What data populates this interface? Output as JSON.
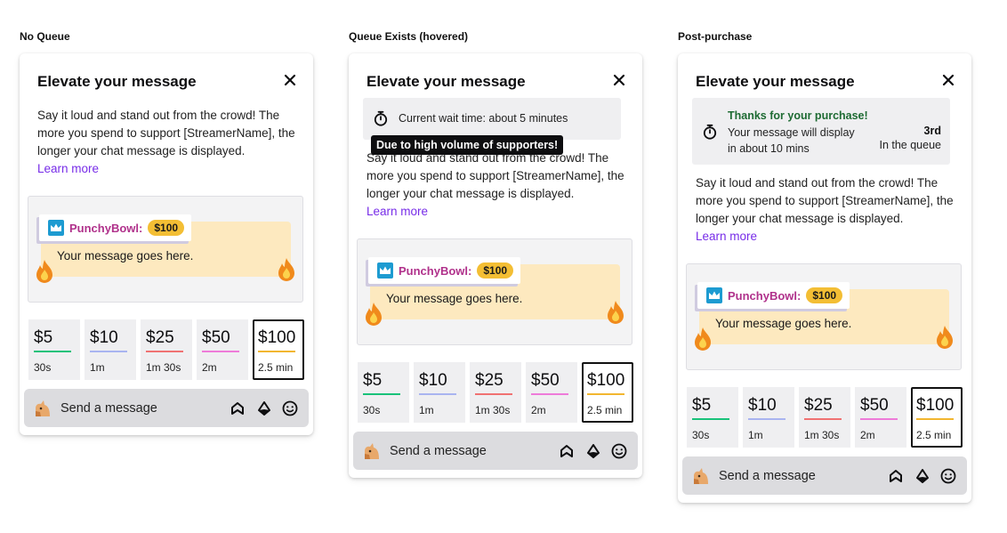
{
  "states": [
    {
      "label": "No Queue"
    },
    {
      "label": "Queue Exists (hovered)"
    },
    {
      "label": "Post-purchase"
    }
  ],
  "card": {
    "title": "Elevate your message",
    "description": "Say it loud and stand out from the crowd! The more you spend to support [StreamerName], the longer your chat message is displayed.",
    "learn_more": "Learn more"
  },
  "preview": {
    "username": "PunchyBowl:",
    "amount": "$100",
    "message": "Your message goes here."
  },
  "tiers": [
    {
      "amount": "$5",
      "duration": "30s",
      "color": "#19c27a"
    },
    {
      "amount": "$10",
      "duration": "1m",
      "color": "#a9b4f0"
    },
    {
      "amount": "$25",
      "duration": "1m 30s",
      "color": "#f07272"
    },
    {
      "amount": "$50",
      "duration": "2m",
      "color": "#ee7bd9"
    },
    {
      "amount": "$100",
      "duration": "2.5 min",
      "color": "#f2b630",
      "selected": true
    }
  ],
  "chat": {
    "placeholder": "Send a message",
    "icons": [
      "bits-icon",
      "diamond-icon",
      "emote-smiley-icon"
    ]
  },
  "queue_hovered": {
    "wait_text": "Current wait time: about 5 minutes",
    "tooltip": "Due to high volume of supporters!"
  },
  "post_purchase": {
    "thanks": "Thanks for your purchase!",
    "line1": "Your message will display",
    "line2": "in about 10 mins",
    "position": "3rd",
    "position_label": "In the queue"
  },
  "colors": {
    "accent_purple": "#772ce8",
    "username_pink": "#b0318b",
    "amount_pill": "#f3be34",
    "bubble": "#fde9bf",
    "thanks_green": "#1e6b33"
  }
}
